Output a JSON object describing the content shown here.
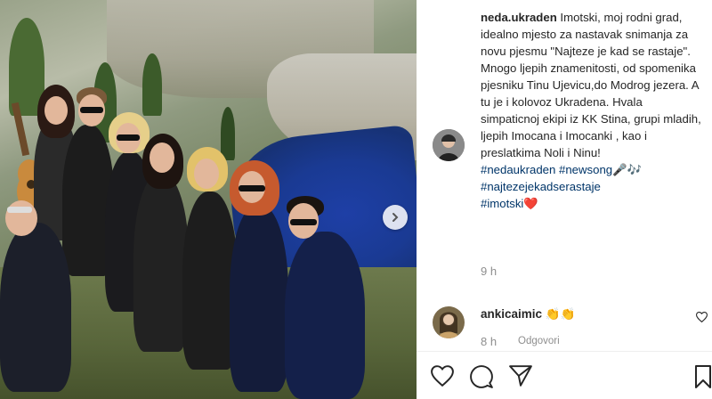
{
  "post": {
    "author": "neda.ukraden",
    "caption_text": "Imotski, moj rodni grad, idealno mjesto za nastavak snimanja za novu pjesmu \"Najteze je kad se rastaje\". Mnogo ljepih znamenitosti, od spomenika pjesniku Tinu Ujevicu,do Modrog jezera. A tu je i kolovoz Ukradena. Hvala simpaticnoj ekipi iz KK Stina, grupi mladih, ljepih Imocana i Imocanki , kao i preslatkima Noli i Ninu!",
    "hashtags": [
      "#nedaukraden",
      "#newsong",
      "#najtezejekadserastaje",
      "#imotski"
    ],
    "emoji_after_newsong": "🎤🎶",
    "emoji_after_imotski": "❤️",
    "time_ago": "9 h"
  },
  "comment": {
    "username": "ankicaimic",
    "text": "👏👏",
    "time_ago": "8 h",
    "reply_label": "Odgovori"
  },
  "icons": {
    "like": "heart-icon",
    "comment": "comment-icon",
    "share": "share-icon",
    "save": "bookmark-icon",
    "next": "chevron-right-icon"
  },
  "colors": {
    "hashtag": "#003569",
    "heart_emoji": "#e0245e",
    "meta_gray": "#8e8e8e"
  }
}
